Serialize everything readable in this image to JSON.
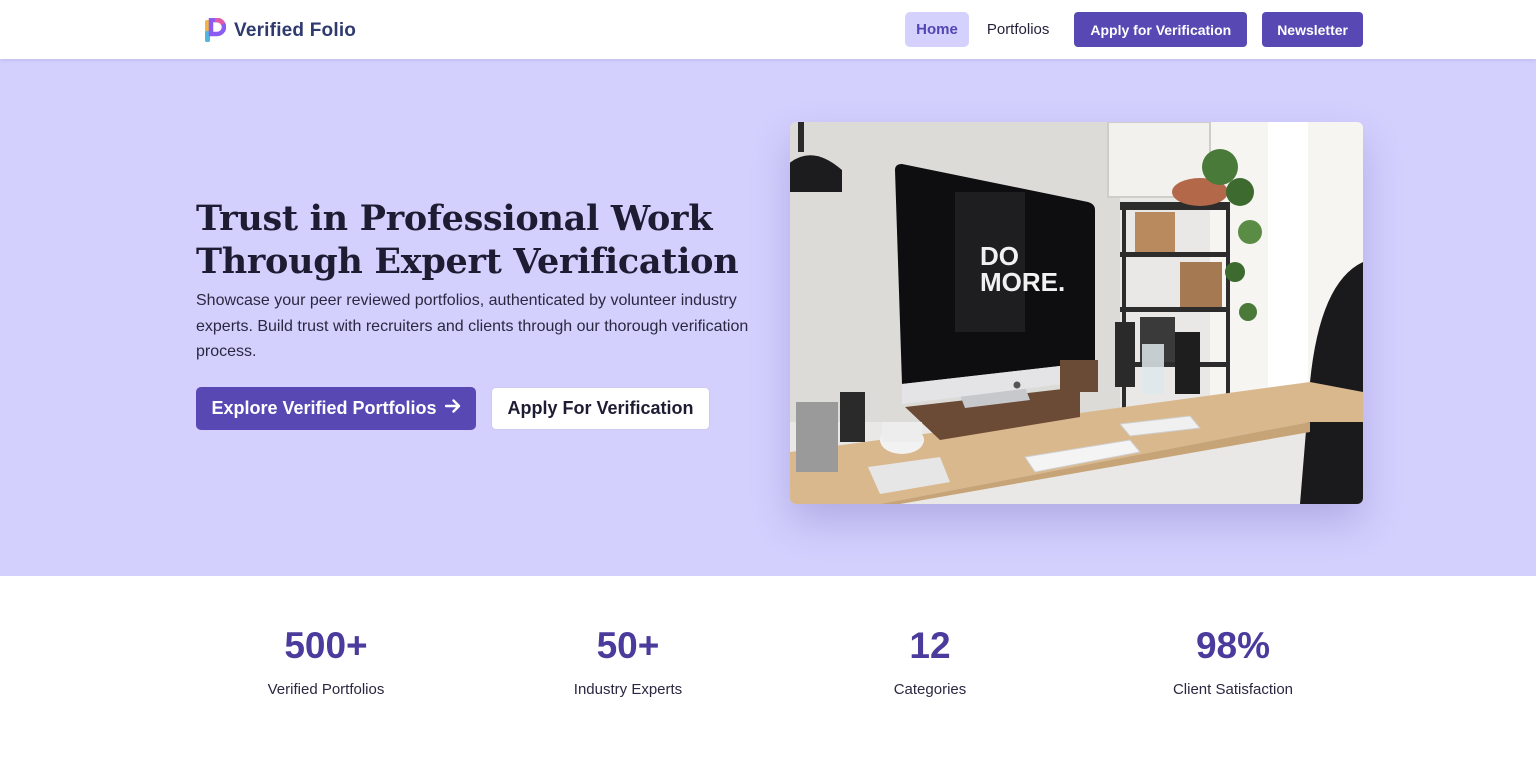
{
  "brand": {
    "name": "Verified Folio",
    "logo_icon": "vf-logo-icon"
  },
  "nav": {
    "home": "Home",
    "portfolios": "Portfolios",
    "apply": "Apply for Verification",
    "newsletter": "Newsletter"
  },
  "hero": {
    "title_line1": "Trust in Professional Work",
    "title_line2": "Through Expert Verification",
    "description": "Showcase your peer reviewed portfolios, authenticated by volunteer industry experts. Build trust with recruiters and clients through our thorough verification process.",
    "primary_cta": "Explore Verified Portfolios",
    "secondary_cta": "Apply For Verification",
    "image_text_line1": "DO",
    "image_text_line2": "MORE."
  },
  "stats": [
    {
      "value": "500+",
      "label": "Verified Portfolios"
    },
    {
      "value": "50+",
      "label": "Industry Experts"
    },
    {
      "value": "12",
      "label": "Categories"
    },
    {
      "value": "98%",
      "label": "Client Satisfaction"
    }
  ],
  "colors": {
    "accent": "#5748b4",
    "hero_bg": "#d3d0fe",
    "stat_value": "#4b3b9c",
    "active_nav_bg": "#d5d1fd"
  }
}
